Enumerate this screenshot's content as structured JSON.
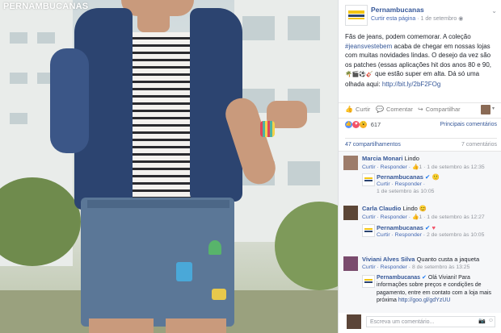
{
  "brand_overlay": "PERNAMBUCANAS",
  "post": {
    "page_name": "Pernambucanas",
    "meta_prefix": "Curtir esta página",
    "date": "1 de setembro",
    "text_1": "Fãs de jeans, podem comemorar. A coleção ",
    "hashtag": "#jeansvestebem",
    "text_2": " acaba de chegar em nossas lojas com muitas novidades lindas. O desejo da vez são os patches (essas aplicações hit dos anos 80 e 90, ",
    "emoji_line": "🌴🎬⚽🎸",
    "text_3": " que estão super em alta. Dá só uma olhada aqui: ",
    "link": "http://bit.ly/2bF2FOg"
  },
  "actions": {
    "like": "Curtir",
    "comment": "Comentar",
    "share": "Compartilhar"
  },
  "reactions": {
    "count": "617",
    "sort": "Principais comentários"
  },
  "shares": {
    "label": "47 compartilhamentos",
    "comments_count": "7 comentários"
  },
  "comments": [
    {
      "name": "Marcia Monari",
      "text": "Lindo",
      "reply": "Curtir · Responder · ",
      "count": "1",
      "date": " · 1 de setembro às 12:35"
    },
    {
      "name": "Pernambucanas",
      "text": "",
      "reply": "Curtir · Responder · ",
      "count": "",
      "date": "1 de setembro às 10:05"
    },
    {
      "name": "Carla Claudio",
      "text": "Lindo",
      "reply": "Curtir · Responder · ",
      "count": "1",
      "date": " · 1 de setembro às 12:27"
    },
    {
      "name": "Pernambucanas",
      "text": "",
      "reply": "Curtir · Responder · ",
      "count": "",
      "date": "2 de setembro às 10:05"
    },
    {
      "name": "Viviani Alves Silva",
      "text": "Quanto custa a jaqueta",
      "reply": "Curtir · Responder · ",
      "count": "",
      "date": "8 de setembro às 13:25"
    },
    {
      "name": "Pernambucanas",
      "text": "Olá Viviani! Para informações sobre preços e condições de pagamento, entre em contato com a loja mais próxima ",
      "link": "http://goo.gl/gdYzUU",
      "reply": "",
      "count": "",
      "date": ""
    }
  ],
  "write_placeholder": "Escreva um comentário...",
  "colors": {
    "fb_blue": "#365899",
    "brand_yellow": "#f2c413",
    "jacket": "#2c4470"
  }
}
